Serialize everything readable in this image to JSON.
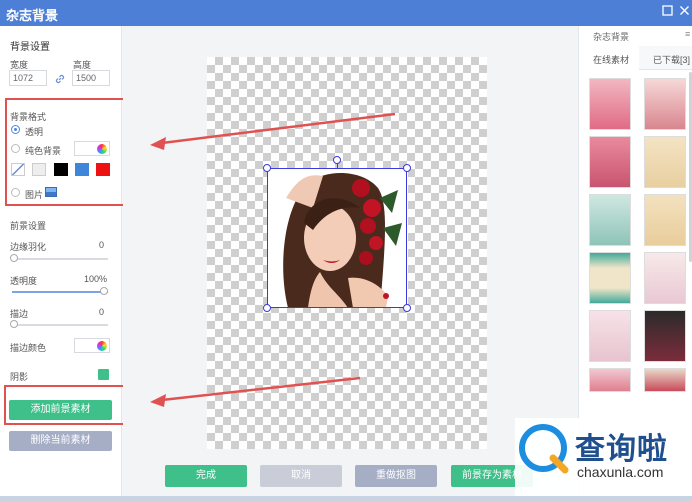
{
  "window": {
    "title": "杂志背景"
  },
  "left": {
    "bg_section": "背景设置",
    "width_label": "宽度",
    "height_label": "高度",
    "width_value": "1072",
    "height_value": "1500",
    "format_title": "背景格式",
    "opt_transparent": "透明",
    "opt_solid": "纯色背景",
    "opt_image": "图片",
    "fg_section": "前景设置",
    "feather_label": "边缘羽化",
    "feather_value": "0",
    "opacity_label": "透明度",
    "opacity_value": "100%",
    "stroke_label": "描边",
    "stroke_value": "0",
    "stroke_color_label": "描边颜色",
    "shadow_label": "阴影",
    "add_button": "添加前景素材",
    "delete_button": "删除当前素材"
  },
  "bottom": {
    "done": "完成",
    "cancel": "取消",
    "recut": "重做抠图",
    "save_fg": "前景存为素材"
  },
  "right": {
    "title": "杂志背景",
    "tab_online": "在线素材",
    "tab_downloaded": "已下载[3]"
  },
  "overlay": {
    "watermark_title": "查询啦",
    "watermark_url": "chaxunla.com"
  },
  "colors": {
    "accent": "#4e7fd6",
    "green": "#3fbf8a",
    "gray_button": "#a6aec6",
    "highlight": "#e05252"
  }
}
